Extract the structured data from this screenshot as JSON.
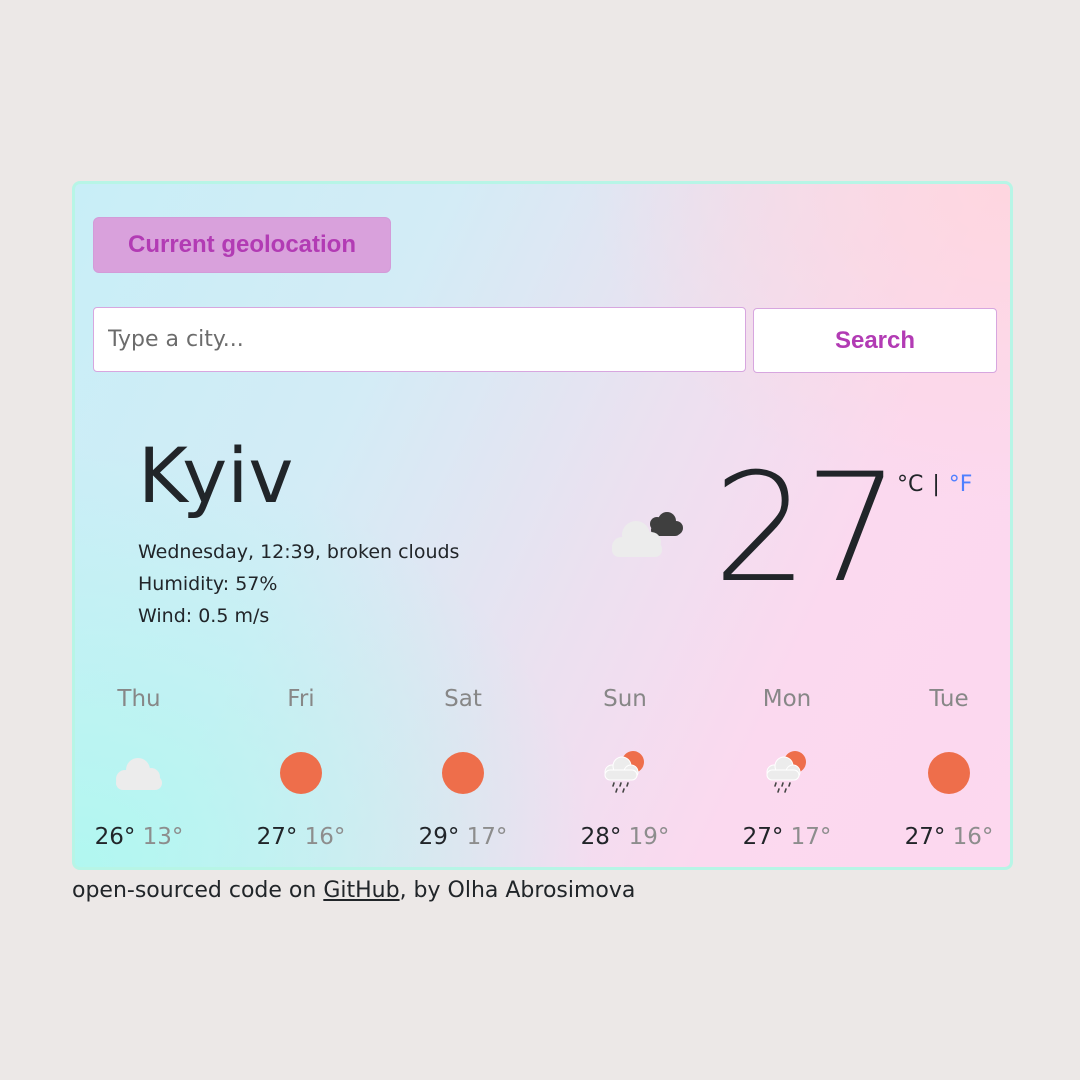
{
  "geolocation_button": {
    "label": "Current geolocation"
  },
  "search": {
    "placeholder": "Type a city...",
    "button_label": "Search"
  },
  "current": {
    "city": "Kyiv",
    "description_line": "Wednesday, 12:39, broken clouds",
    "humidity_line": "Humidity: 57%",
    "wind_line": "Wind: 0.5 m/s",
    "temperature": "27",
    "icon": "broken-clouds-icon",
    "unit_celsius": "°C",
    "unit_separator": "|",
    "unit_fahrenheit": "°F"
  },
  "forecast": [
    {
      "day": "Thu",
      "max": "26°",
      "min": "13°",
      "icon": "cloud-icon"
    },
    {
      "day": "Fri",
      "max": "27°",
      "min": "16°",
      "icon": "sun-icon"
    },
    {
      "day": "Sat",
      "max": "29°",
      "min": "17°",
      "icon": "sun-icon"
    },
    {
      "day": "Sun",
      "max": "28°",
      "min": "19°",
      "icon": "rain-sun-icon"
    },
    {
      "day": "Mon",
      "max": "27°",
      "min": "17°",
      "icon": "rain-sun-icon"
    },
    {
      "day": "Tue",
      "max": "27°",
      "min": "16°",
      "icon": "sun-icon"
    }
  ],
  "footer": {
    "prefix": "open-sourced code on ",
    "link_text": "GitHub",
    "suffix": ", by Olha Abrosimova"
  },
  "colors": {
    "accent": "#b23bb4",
    "geo_button_bg": "#d9a1dc",
    "sun": "#ee6e4b",
    "fahrenheit_link": "#4f7fff",
    "card_border": "#b7f5e6"
  }
}
